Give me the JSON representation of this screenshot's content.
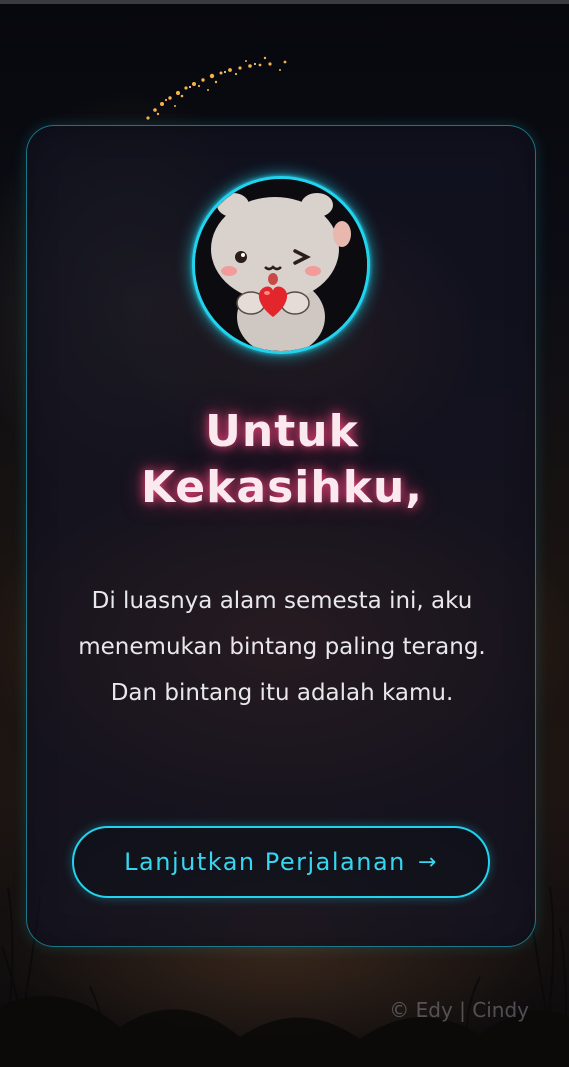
{
  "card": {
    "title_line1": "Untuk",
    "title_line2": "Kekasihku,",
    "message": "Di luasnya alam semesta ini, aku menemukan bintang paling terang. Dan bintang itu adalah kamu.",
    "cta_label": "Lanjutkan Perjalanan",
    "cta_arrow": "→",
    "avatar_icon": "winking-cat-holding-heart-icon"
  },
  "footer": {
    "credit": "© Edy | Cindy"
  },
  "colors": {
    "accent_cyan": "#22d3ee",
    "title_glow_pink": "#ff4682",
    "card_bg": "#141422"
  }
}
